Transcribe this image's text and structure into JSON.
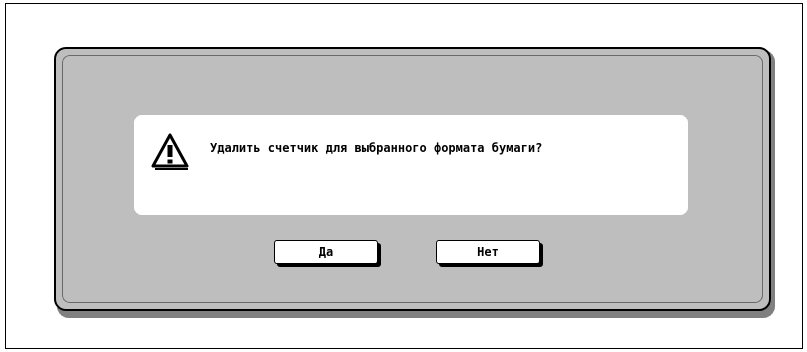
{
  "dialog": {
    "message": "Удалить счетчик для выбранного формата бумаги?",
    "icon": "warning-triangle-icon",
    "buttons": {
      "yes_label": "Да",
      "no_label": "Нет"
    }
  }
}
